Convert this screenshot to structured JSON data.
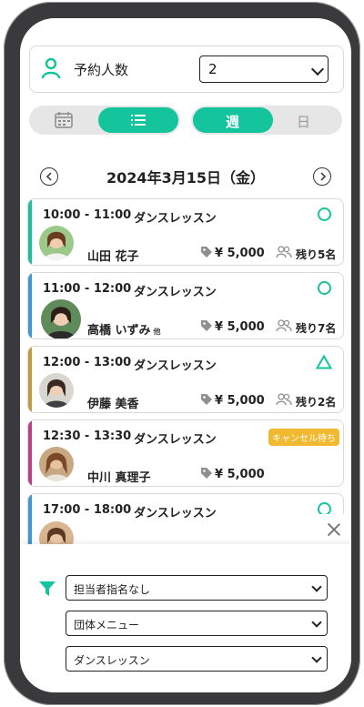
{
  "people": {
    "label": "予約人数",
    "value": "2"
  },
  "view_toggle": {
    "week": "週",
    "day": "日"
  },
  "date": {
    "label": "2024年3月15日（金）"
  },
  "lessons": [
    {
      "time": "10:00 - 11:00",
      "title": "ダンスレッスン",
      "instructor": "山田 花子",
      "others": "",
      "price": "¥ 5,000",
      "remaining": "残り5名",
      "status": "circle",
      "bar_color": "#13c49d"
    },
    {
      "time": "11:00 - 12:00",
      "title": "ダンスレッスン",
      "instructor": "高橋 いずみ",
      "others": "他",
      "price": "¥ 5,000",
      "remaining": "残り7名",
      "status": "circle",
      "bar_color": "#3a9ad9"
    },
    {
      "time": "12:00 - 13:00",
      "title": "ダンスレッスン",
      "instructor": "伊藤 美香",
      "others": "",
      "price": "¥ 5,000",
      "remaining": "残り2名",
      "status": "triangle",
      "bar_color": "#c89a3c"
    },
    {
      "time": "12:30 - 13:30",
      "title": "ダンスレッスン",
      "instructor": "中川 真理子",
      "others": "",
      "price": "¥ 5,000",
      "remaining": "",
      "status": "キャンセル待ち",
      "bar_color": "#c23a8a"
    },
    {
      "time": "17:00 - 18:00",
      "title": "ダンスレッスン",
      "instructor": "",
      "others": "",
      "price": "",
      "remaining": "",
      "status": "circle",
      "bar_color": "#3a9ad9"
    }
  ],
  "filters": {
    "instructor": "担当者指名なし",
    "menu": "団体メニュー",
    "lesson": "ダンスレッスン"
  },
  "colors": {
    "accent": "#13c49d",
    "badge": "#f0b92f"
  },
  "icons": [
    "person-icon",
    "calendar-icon",
    "list-icon",
    "chevron-left-icon",
    "chevron-right-icon",
    "tag-icon",
    "people-icon",
    "filter-icon",
    "close-icon"
  ]
}
